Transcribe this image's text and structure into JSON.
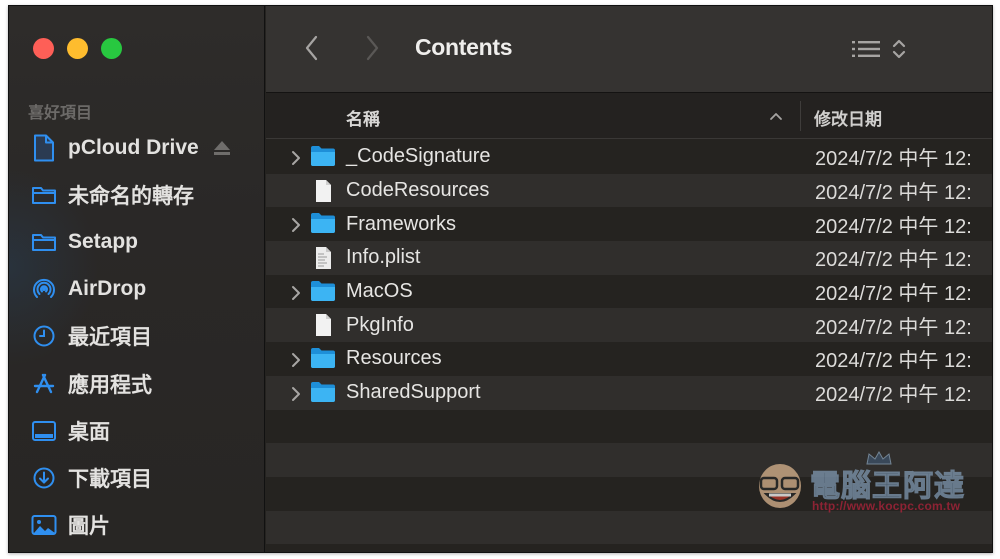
{
  "window": {
    "title": "Contents",
    "traffic_lights": {
      "close": "#fe5f57",
      "minimize": "#febc2e",
      "zoom": "#28c840"
    }
  },
  "sidebar": {
    "section_label": "喜好項目",
    "items": [
      {
        "label": "pCloud Drive",
        "icon": "document-icon",
        "has_eject": true
      },
      {
        "label": "未命名的轉存",
        "icon": "folder-icon"
      },
      {
        "label": "Setapp",
        "icon": "folder-icon"
      },
      {
        "label": "AirDrop",
        "icon": "airdrop-icon"
      },
      {
        "label": "最近項目",
        "icon": "clock-icon"
      },
      {
        "label": "應用程式",
        "icon": "applications-icon"
      },
      {
        "label": "桌面",
        "icon": "desktop-icon"
      },
      {
        "label": "下載項目",
        "icon": "download-icon"
      },
      {
        "label": "圖片",
        "icon": "pictures-icon"
      }
    ],
    "accent": "#2f8ff0"
  },
  "toolbar": {
    "back": "chevron-left-icon",
    "forward": "chevron-right-icon",
    "view_mode": "list-view-icon"
  },
  "columns": {
    "name": "名稱",
    "sort": "ascending",
    "date_modified": "修改日期"
  },
  "files": [
    {
      "name": "_CodeSignature",
      "type": "folder",
      "expandable": true,
      "date": "2024/7/2 中午 12:"
    },
    {
      "name": "CodeResources",
      "type": "file",
      "expandable": false,
      "date": "2024/7/2 中午 12:"
    },
    {
      "name": "Frameworks",
      "type": "folder",
      "expandable": true,
      "date": "2024/7/2 中午 12:"
    },
    {
      "name": "Info.plist",
      "type": "plist",
      "expandable": false,
      "date": "2024/7/2 中午 12:"
    },
    {
      "name": "MacOS",
      "type": "folder",
      "expandable": true,
      "date": "2024/7/2 中午 12:"
    },
    {
      "name": "PkgInfo",
      "type": "file",
      "expandable": false,
      "date": "2024/7/2 中午 12:"
    },
    {
      "name": "Resources",
      "type": "folder",
      "expandable": true,
      "date": "2024/7/2 中午 12:"
    },
    {
      "name": "SharedSupport",
      "type": "folder",
      "expandable": true,
      "date": "2024/7/2 中午 12:"
    }
  ],
  "empty_rows": 4,
  "watermark": {
    "title": "電腦王阿達",
    "url": "http://www.kocpc.com.tw"
  }
}
